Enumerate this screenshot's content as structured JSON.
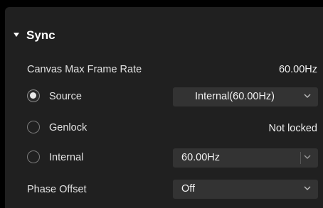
{
  "section": {
    "title": "Sync",
    "expanded": true
  },
  "canvas_max_frame_rate": {
    "label": "Canvas Max Frame Rate",
    "value": "60.00Hz"
  },
  "sync_options": [
    {
      "label": "Source",
      "selected": true,
      "control": "dropdown",
      "value": "Internal(60.00Hz)"
    },
    {
      "label": "Genlock",
      "selected": false,
      "control": "status",
      "value": "Not locked"
    },
    {
      "label": "Internal",
      "selected": false,
      "control": "dropdown",
      "value": "60.00Hz"
    }
  ],
  "phase_offset": {
    "label": "Phase Offset",
    "value": "Off"
  },
  "icons": {
    "section_toggle": "caret-down-icon",
    "dropdown_arrow": "chevron-down-icon"
  },
  "colors": {
    "background": "#000000",
    "panel": "#202020",
    "dropdown": "#333333",
    "text": "#e6e6e6"
  }
}
